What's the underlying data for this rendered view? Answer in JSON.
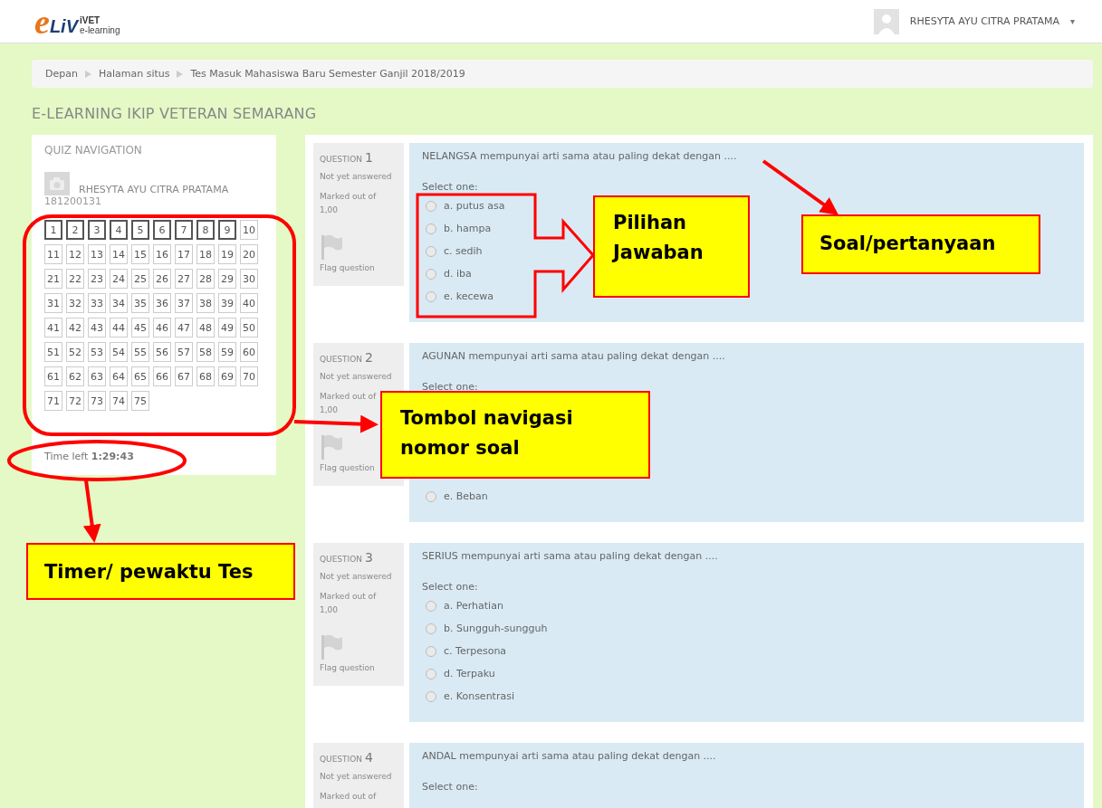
{
  "header": {
    "logo": {
      "mark": "e",
      "name": "LiV",
      "superscript": "iVET",
      "tagline": "e-learning"
    },
    "user_name": "RHESYTA AYU CITRA PRATAMA",
    "menu_caret": "▾"
  },
  "breadcrumb": [
    "Depan",
    "Halaman situs",
    "Tes Masuk Mahasiswa Baru Semester Ganjil 2018/2019"
  ],
  "site_heading": "E-LEARNING IKIP VETERAN SEMARANG",
  "quiz_navigation": {
    "title": "QUIZ NAVIGATION",
    "user_name": "RHESYTA AYU CITRA PRATAMA",
    "user_id": "181200131",
    "time_left": "Time left **1:29:43**",
    "buttons": [
      {
        "label": "1",
        "on_page": true
      },
      {
        "label": "2",
        "on_page": true
      },
      {
        "label": "3",
        "on_page": true
      },
      {
        "label": "4",
        "on_page": true
      },
      {
        "label": "5",
        "on_page": true
      },
      {
        "label": "6",
        "on_page": true
      },
      {
        "label": "7",
        "on_page": true
      },
      {
        "label": "8",
        "on_page": true
      },
      {
        "label": "9",
        "on_page": true
      },
      {
        "label": "10",
        "on_page": false
      },
      {
        "label": "11",
        "on_page": false
      },
      {
        "label": "12",
        "on_page": false
      },
      {
        "label": "13",
        "on_page": false
      },
      {
        "label": "14",
        "on_page": false
      },
      {
        "label": "15",
        "on_page": false
      },
      {
        "label": "16",
        "on_page": false
      },
      {
        "label": "17",
        "on_page": false
      },
      {
        "label": "18",
        "on_page": false
      },
      {
        "label": "19",
        "on_page": false
      },
      {
        "label": "20",
        "on_page": false
      },
      {
        "label": "21",
        "on_page": false
      },
      {
        "label": "22",
        "on_page": false
      },
      {
        "label": "23",
        "on_page": false
      },
      {
        "label": "24",
        "on_page": false
      },
      {
        "label": "25",
        "on_page": false
      },
      {
        "label": "26",
        "on_page": false
      },
      {
        "label": "27",
        "on_page": false
      },
      {
        "label": "28",
        "on_page": false
      },
      {
        "label": "29",
        "on_page": false
      },
      {
        "label": "30",
        "on_page": false
      },
      {
        "label": "31",
        "on_page": false
      },
      {
        "label": "32",
        "on_page": false
      },
      {
        "label": "33",
        "on_page": false
      },
      {
        "label": "34",
        "on_page": false
      },
      {
        "label": "35",
        "on_page": false
      },
      {
        "label": "36",
        "on_page": false
      },
      {
        "label": "37",
        "on_page": false
      },
      {
        "label": "38",
        "on_page": false
      },
      {
        "label": "39",
        "on_page": false
      },
      {
        "label": "40",
        "on_page": false
      },
      {
        "label": "41",
        "on_page": false
      },
      {
        "label": "42",
        "on_page": false
      },
      {
        "label": "43",
        "on_page": false
      },
      {
        "label": "44",
        "on_page": false
      },
      {
        "label": "45",
        "on_page": false
      },
      {
        "label": "46",
        "on_page": false
      },
      {
        "label": "47",
        "on_page": false
      },
      {
        "label": "48",
        "on_page": false
      },
      {
        "label": "49",
        "on_page": false
      },
      {
        "label": "50",
        "on_page": false
      },
      {
        "label": "51",
        "on_page": false
      },
      {
        "label": "52",
        "on_page": false
      },
      {
        "label": "53",
        "on_page": false
      },
      {
        "label": "54",
        "on_page": false
      },
      {
        "label": "55",
        "on_page": false
      },
      {
        "label": "56",
        "on_page": false
      },
      {
        "label": "57",
        "on_page": false
      },
      {
        "label": "58",
        "on_page": false
      },
      {
        "label": "59",
        "on_page": false
      },
      {
        "label": "60",
        "on_page": false
      },
      {
        "label": "61",
        "on_page": false
      },
      {
        "label": "62",
        "on_page": false
      },
      {
        "label": "63",
        "on_page": false
      },
      {
        "label": "64",
        "on_page": false
      },
      {
        "label": "65",
        "on_page": false
      },
      {
        "label": "66",
        "on_page": false
      },
      {
        "label": "67",
        "on_page": false
      },
      {
        "label": "68",
        "on_page": false
      },
      {
        "label": "69",
        "on_page": false
      },
      {
        "label": "70",
        "on_page": false
      },
      {
        "label": "71",
        "on_page": false
      },
      {
        "label": "72",
        "on_page": false
      },
      {
        "label": "73",
        "on_page": false
      },
      {
        "label": "74",
        "on_page": false
      },
      {
        "label": "75",
        "on_page": false
      }
    ]
  },
  "questions": [
    {
      "label": "QUESTION",
      "number": "1",
      "status": "Not yet answered",
      "mark": "Marked out of 1,00",
      "flag": "Flag question",
      "prompt": "NELANGSA mempunyai arti sama atau paling dekat dengan ....",
      "select_label": "Select one:",
      "options": [
        {
          "text": "a. putus asa",
          "selected": false
        },
        {
          "text": "b. hampa",
          "selected": false
        },
        {
          "text": "c. sedih",
          "selected": false
        },
        {
          "text": "d. iba",
          "selected": false
        },
        {
          "text": "e. kecewa",
          "selected": false
        }
      ]
    },
    {
      "label": "QUESTION",
      "number": "2",
      "status": "Not yet answered",
      "mark": "Marked out of 1,00",
      "flag": "Flag question",
      "prompt": "AGUNAN mempunyai arti sama atau paling dekat dengan ....",
      "select_label": "Select one:",
      "options": [
        {
          "text": "e. Beban",
          "selected": false
        }
      ]
    },
    {
      "label": "QUESTION",
      "number": "3",
      "status": "Not yet answered",
      "mark": "Marked out of 1,00",
      "flag": "Flag question",
      "prompt": "SERIUS mempunyai arti sama atau paling dekat dengan ....",
      "select_label": "Select one:",
      "options": [
        {
          "text": "a. Perhatian",
          "selected": false
        },
        {
          "text": "b. Sungguh-sungguh",
          "selected": false
        },
        {
          "text": "c. Terpesona",
          "selected": false
        },
        {
          "text": "d. Terpaku",
          "selected": false
        },
        {
          "text": "e. Konsentrasi",
          "selected": false
        }
      ]
    },
    {
      "label": "QUESTION",
      "number": "4",
      "status": "Not yet answered",
      "mark": "Marked out of",
      "prompt": "ANDAL mempunyai arti sama atau paling dekat dengan ....",
      "select_label": "Select one:"
    }
  ],
  "annotations": [
    {
      "kind": "options",
      "text": "Pilihan Jawaban"
    },
    {
      "kind": "question",
      "text": "Soal/pertanyaan"
    },
    {
      "kind": "navigation",
      "text": "Tombol navigasi nomor soal"
    },
    {
      "kind": "timer",
      "text": "Timer/ pewaktu Tes"
    }
  ]
}
